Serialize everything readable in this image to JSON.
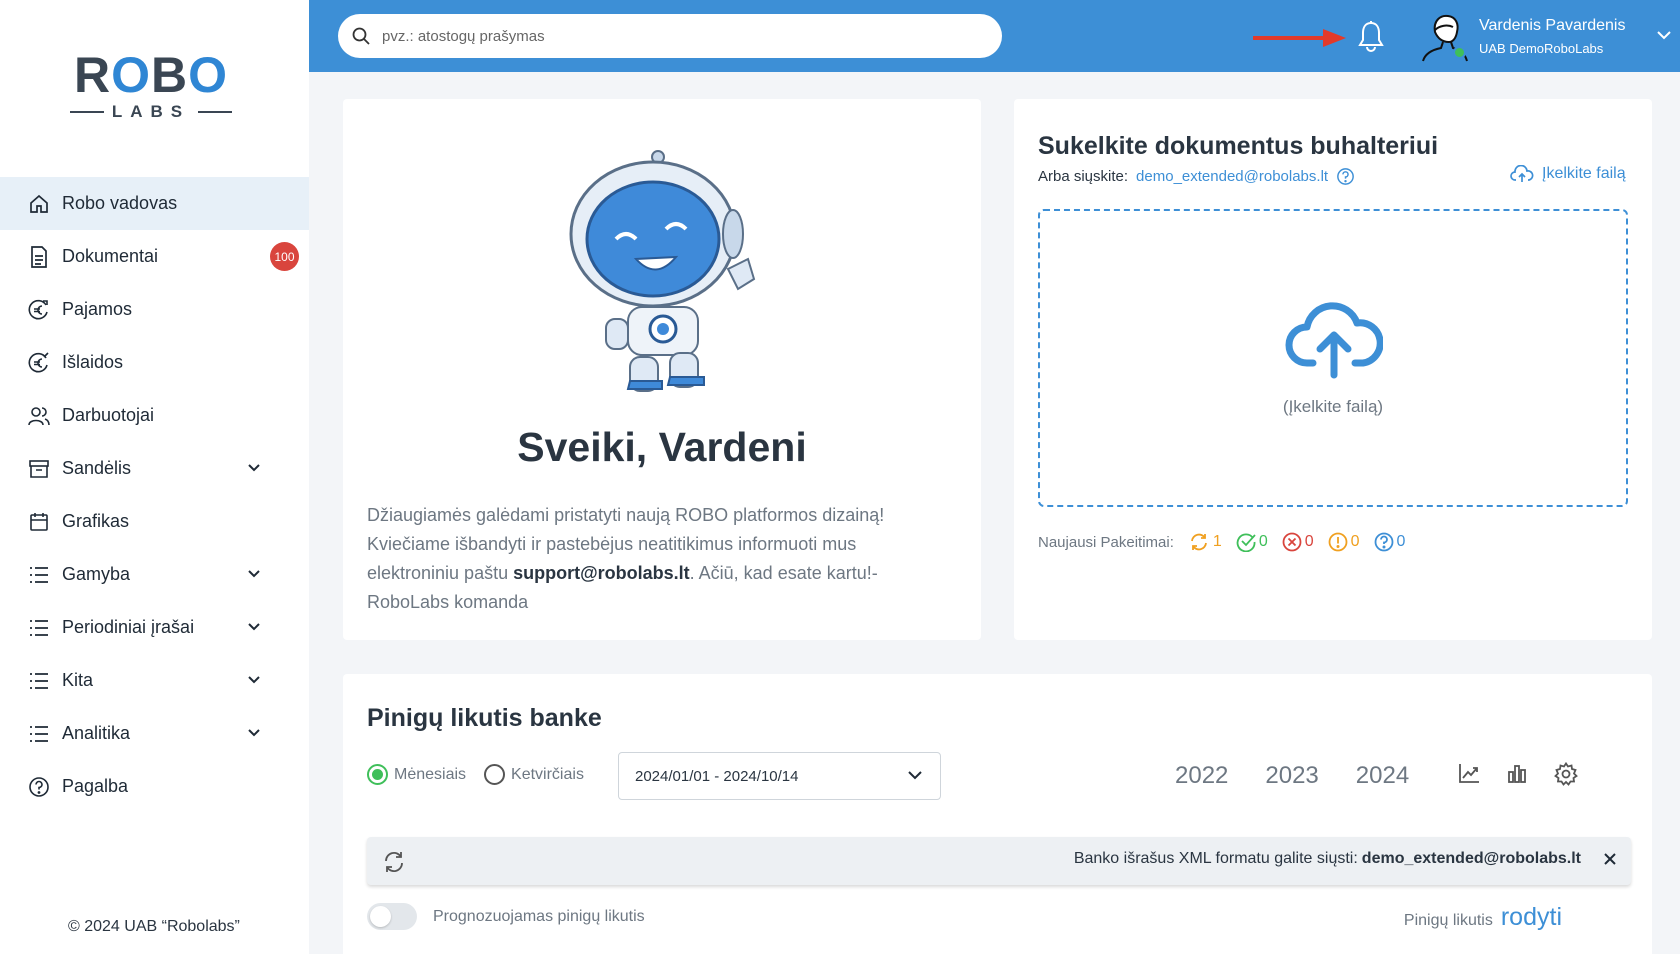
{
  "logo": {
    "top": "ROBO",
    "bottom": "LABS"
  },
  "sidebar": {
    "items": [
      {
        "label": "Robo vadovas",
        "icon": "home-icon"
      },
      {
        "label": "Dokumentai",
        "icon": "document-icon",
        "badge": "100"
      },
      {
        "label": "Pajamos",
        "icon": "euro-in-icon"
      },
      {
        "label": "Išlaidos",
        "icon": "euro-out-icon"
      },
      {
        "label": "Darbuotojai",
        "icon": "people-icon"
      },
      {
        "label": "Sandėlis",
        "icon": "archive-icon"
      },
      {
        "label": "Grafikas",
        "icon": "calendar-icon"
      },
      {
        "label": "Gamyba",
        "icon": "list-icon"
      },
      {
        "label": "Periodiniai įrašai",
        "icon": "list-icon"
      },
      {
        "label": "Kita",
        "icon": "list-icon"
      },
      {
        "label": "Analitika",
        "icon": "list-icon"
      },
      {
        "label": "Pagalba",
        "icon": "help-icon"
      }
    ],
    "copyright": "© 2024 UAB “Robolabs”"
  },
  "header": {
    "search_placeholder": "pvz.: atostogų prašymas",
    "user_name": "Vardenis Pavardenis",
    "user_company": "UAB DemoRoboLabs"
  },
  "welcome": {
    "title": "Sveiki, Vardeni",
    "text_1": "Džiaugiamės galėdami pristatyti naują ROBO platformos dizainą! Kviečiame išbandyti ir pastebėjus neatitikimus informuoti mus elektroniniu paštu ",
    "email": "support@robolabs.lt",
    "text_2": ". Ačiū, kad esate kartu!- RoboLabs komanda"
  },
  "upload": {
    "title": "Sukelkite dokumentus buhalteriui",
    "send_label": "Arba siųskite:",
    "email": "demo_extended@robolabs.lt",
    "upload_link": "Įkelkite failą",
    "dropzone_text": "(Įkelkite failą)",
    "changes_label": "Naujausi Pakeitimai:",
    "changes": {
      "processing": "1",
      "accepted": "0",
      "rejected": "0",
      "warning": "0",
      "question": "0"
    }
  },
  "bank": {
    "title": "Pinigų likutis banke",
    "radio_monthly": "Mėnesiais",
    "radio_quarterly": "Ketvirčiais",
    "date_range": "2024/01/01 - 2024/10/14",
    "years": [
      "2022",
      "2023",
      "2024"
    ],
    "banner_text": "Banko išrašus XML formatu galite siųsti:",
    "banner_email": "demo_extended@robolabs.lt",
    "forecast_label": "Prognozuojamas pinigų likutis",
    "balance_label": "Pinigų likutis",
    "balance_link": "rodyti"
  },
  "colors": {
    "primary": "#3d8fd6",
    "badge": "#d9453d",
    "success": "#3fbf5a"
  }
}
